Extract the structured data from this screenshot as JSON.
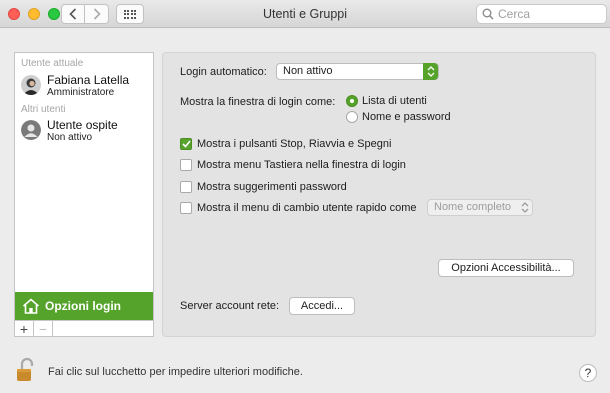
{
  "window": {
    "title": "Utenti e Gruppi"
  },
  "toolbar": {
    "back_icon": "chevron-left",
    "forward_icon": "chevron-right",
    "grid_icon": "show-all-grid"
  },
  "search": {
    "placeholder": "Cerca",
    "value": ""
  },
  "sidebar": {
    "current_user_section": "Utente attuale",
    "current_user": {
      "name": "Fabiana Latella",
      "role": "Amministratore"
    },
    "other_users_section": "Altri utenti",
    "other_users": [
      {
        "name": "Utente ospite",
        "status": "Non attivo"
      }
    ],
    "login_options_label": "Opzioni login",
    "add_label": "+",
    "remove_label": "−"
  },
  "panel": {
    "auto_login_label": "Login automatico:",
    "auto_login_value": "Non attivo",
    "show_login_window_label": "Mostra la finestra di login come:",
    "radio_options": [
      {
        "label": "Lista di utenti",
        "selected": true
      },
      {
        "label": "Nome e password",
        "selected": false
      }
    ],
    "checkboxes": [
      {
        "label": "Mostra i pulsanti Stop, Riavvia e Spegni",
        "checked": true
      },
      {
        "label": "Mostra menu Tastiera nella finestra di login",
        "checked": false
      },
      {
        "label": "Mostra suggerimenti password",
        "checked": false
      },
      {
        "label": "Mostra il menu di cambio utente rapido come",
        "checked": false
      }
    ],
    "fast_switch_value": "Nome completo",
    "accessibility_button": "Opzioni Accessibilità...",
    "network_server_label": "Server account rete:",
    "join_button": "Accedi..."
  },
  "footer": {
    "lock_text": "Fai clic sul lucchetto per impedire ulteriori modifiche.",
    "help_label": "?"
  },
  "colors": {
    "accent": "#55a32a",
    "window_bg": "#ececec"
  }
}
